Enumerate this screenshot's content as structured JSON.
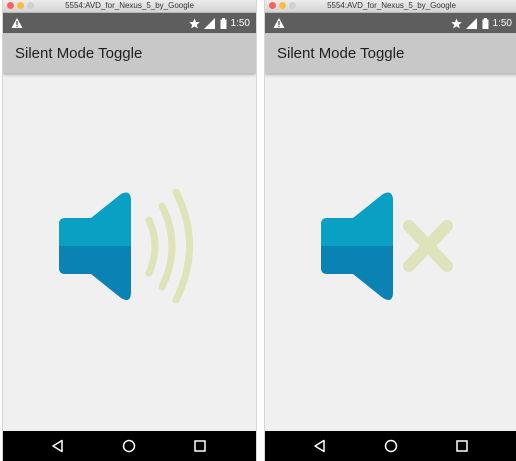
{
  "screens": [
    {
      "state": "sound on",
      "window_title": "5554:AVD_for_Nexus_5_by_Google",
      "status_time": "1:50",
      "app_title": "Silent Mode Toggle"
    },
    {
      "state": "silent",
      "window_title": "5554:AVD_for_Nexus_5_by_Google",
      "status_time": "1:50",
      "app_title": "Silent Mode Toggle"
    }
  ],
  "colors": {
    "speaker_top": "#0aa0c4",
    "speaker_bottom": "#0a82b4",
    "waves": "#dfe3b8",
    "mute_x": "#dfe3bc",
    "status_bar": "#5e5e5e",
    "app_bar": "#c8c8c8",
    "nav_bar": "#000000",
    "window_close": "#fc605c",
    "window_min": "#fdbc40",
    "window_max": "#d0d0d0"
  },
  "icons": {
    "status_left": "warning-icon",
    "status_right": [
      "star-icon",
      "signal-icon",
      "battery-icon"
    ],
    "nav": [
      "back-icon",
      "home-icon",
      "recents-icon"
    ],
    "center_on": "speaker-sound-on-icon",
    "center_off": "speaker-muted-icon"
  }
}
